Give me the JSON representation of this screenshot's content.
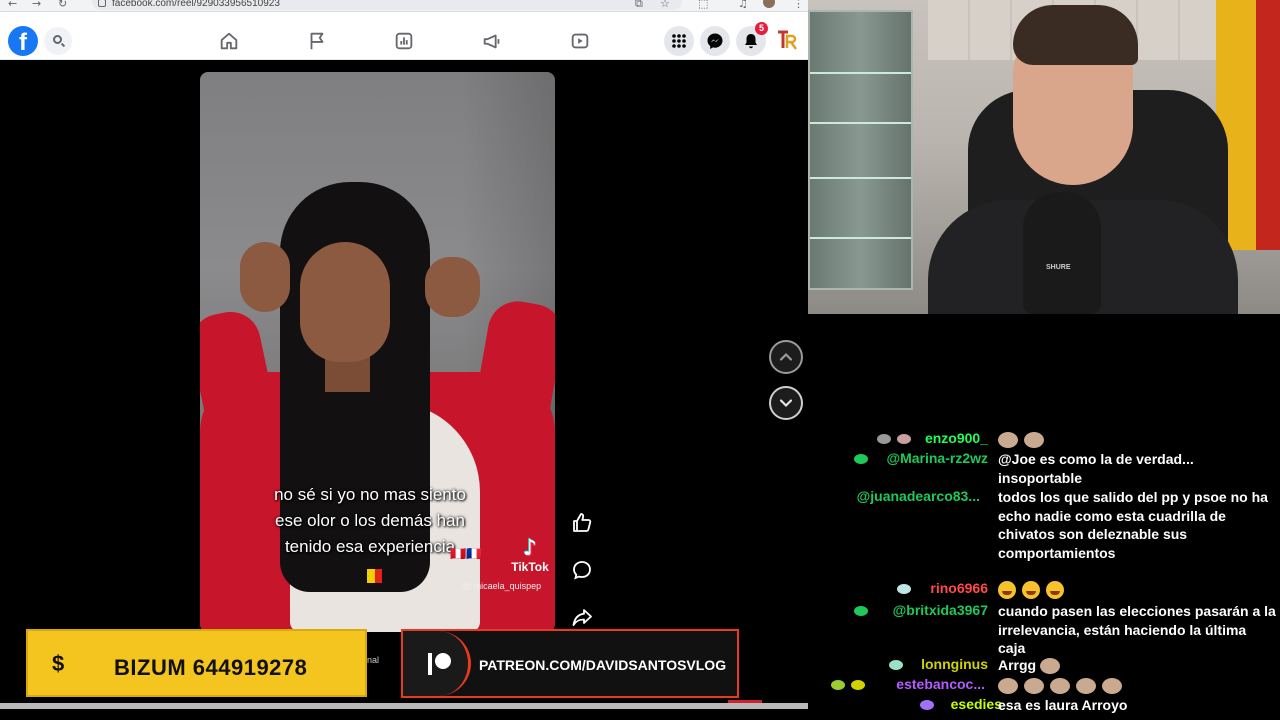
{
  "browser": {
    "url": "facebook.com/reel/929033956510923",
    "notifications_count": "5"
  },
  "fb": {
    "logo_letter": "f"
  },
  "reel": {
    "caption_lines": [
      "no sé si yo no mas siento",
      "ese olor o los demás han",
      "tenido esa experiencia"
    ],
    "flags": "🇵🇪🇫🇷",
    "tiktok_label": "TikTok",
    "tiktok_note": "♪",
    "tiktok_user": "@ micaela_quispep",
    "partial_label": "nal"
  },
  "overlays": {
    "bizum_symbol": "$",
    "bizum_text": "BIZUM 644919278",
    "patreon_text": "PATREON.COM/DAVIDSANTOSVLOG"
  },
  "webcam": {
    "mic_brand": "SHURE"
  },
  "chat": {
    "messages": [
      {
        "user": "enzo900_",
        "color": "#1eff5a",
        "text": "",
        "emotes": 2,
        "badges": [
          "#c8a0a0",
          "#999999"
        ]
      },
      {
        "user": "@Marina-rz2wz",
        "color": "#1ec95a",
        "text": "@Joe es como la de verdad... insoportable",
        "emotes": 0,
        "badges": [
          "#1ec95a"
        ]
      },
      {
        "user": "@juanadearco83...",
        "color": "#1ec95a",
        "text": "todos los que salido del pp y psoe no ha echo nadie como esta cuadrilla de chivatos son deleznable sus comportamientos",
        "emotes": 0,
        "badges": []
      },
      {
        "user": "rino6966",
        "color": "#ff4a4a",
        "text": "",
        "emojis": 3,
        "badges": [
          "#bfe6e6"
        ]
      },
      {
        "user": "@britxida3967",
        "color": "#1ec95a",
        "text": "cuando pasen las elecciones pasarán a la irrelevancia, están haciendo la última caja",
        "emotes": 0,
        "badges": [
          "#1ec95a"
        ]
      },
      {
        "user": "lonnginus",
        "color": "#d2d200",
        "text": "Arrgg",
        "emotes": 1,
        "badges": [
          "#9be0c8"
        ]
      },
      {
        "user": "estebancoc...",
        "color": "#b65cff",
        "text": "",
        "emotes": 5,
        "badges": [
          "#d2d200",
          "#9acd32"
        ]
      },
      {
        "user": "esedies",
        "color": "#c6ff00",
        "text": "esa es laura Arroyo",
        "emotes": 0,
        "badges": [
          "#a070ff"
        ]
      }
    ]
  }
}
